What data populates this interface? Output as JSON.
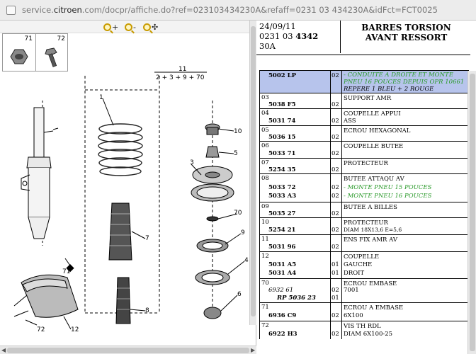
{
  "browser": {
    "url_prefix": "service.",
    "url_domain": "citroen",
    "url_rest": ".com/docpr/affiche.do?ref=023103434230A&refaff=0231 03 434230A&idFct=FCT0025"
  },
  "zoom_toolbar": {
    "zoom_in_label": "+",
    "zoom_out_label": "-",
    "zoom_fit_label": "✣"
  },
  "thumbnails": [
    {
      "label": "71"
    },
    {
      "label": "72"
    }
  ],
  "diagram": {
    "callouts": [
      "1",
      "2",
      "3",
      "4",
      "5",
      "6",
      "7",
      "8",
      "9",
      "10",
      "70",
      "71",
      "72",
      "12"
    ],
    "formula_top": "11",
    "formula_bottom": "2 + 3 + 9 + 70"
  },
  "header": {
    "date": "24/09/11",
    "ref_normal": "0231 03 ",
    "ref_bold": "4342",
    "ref_suffix": "30A",
    "title_line1": "BARRES TORSION",
    "title_line2": "AVANT RESSORT"
  },
  "parts": [
    {
      "idx": "",
      "ref": "5002 LP",
      "qty": "02",
      "lines": [
        "- CONDUITE A DROITE ET MONTE",
        "PNEU 16 POUCES DEPUIS OPR 10661",
        "REPERE 1 BLEU + 2 ROUGE"
      ]
    },
    {
      "idx": "03",
      "ref": "5038 F5",
      "qty": "02",
      "lines": [
        "SUPPORT AMR"
      ]
    },
    {
      "idx": "04",
      "ref": "5031 74",
      "qty": "02",
      "lines": [
        "COUPELLE APPUI",
        "ASS"
      ]
    },
    {
      "idx": "05",
      "ref": "5036 15",
      "qty": "02",
      "lines": [
        "ECROU HEXAGONAL"
      ]
    },
    {
      "idx": "06",
      "ref": "5033 71",
      "qty": "02",
      "lines": [
        "COUPELLE BUTEE"
      ]
    },
    {
      "idx": "07",
      "ref": "5254 35",
      "qty": "02",
      "lines": [
        "PROTECTEUR"
      ]
    },
    {
      "idx": "08",
      "ref": "5033 72",
      "ref2": "5033 A3",
      "qty": "02",
      "qty2": "02",
      "lines": [
        "BUTEE ATTAQU AV",
        "- MONTE PNEU 15 POUCES",
        "- MONTE PNEU 16 POUCES"
      ]
    },
    {
      "idx": "09",
      "ref": "5035 27",
      "qty": "02",
      "lines": [
        "BUTEE A BILLES"
      ]
    },
    {
      "idx": "10",
      "ref": "5254 21",
      "qty": "02",
      "lines": [
        "PROTECTEUR",
        "DIAM 18X13,6 E=5,6"
      ]
    },
    {
      "idx": "11",
      "ref": "5031 96",
      "qty": "02",
      "lines": [
        "ENS FIX AMR AV"
      ]
    },
    {
      "idx": "12",
      "ref": "5031 A5",
      "ref2": "5031 A4",
      "qty": "01",
      "qty2": "01",
      "lines": [
        "COUPELLE",
        "GAUCHE",
        "DROIT"
      ]
    },
    {
      "idx": "70",
      "ref": "6932 61",
      "refsub": "RP 5036 23",
      "qty": "02",
      "qty2": "01",
      "lines": [
        "ECROU EMBASE",
        "7001"
      ]
    },
    {
      "idx": "71",
      "ref": "6936 C9",
      "qty": "02",
      "lines": [
        "ECROU A EMBASE",
        "6X100"
      ]
    },
    {
      "idx": "72",
      "ref": "6922 H3",
      "qty": "02",
      "lines": [
        "VIS TH RDL",
        "DIAM 6X100-25"
      ]
    }
  ]
}
